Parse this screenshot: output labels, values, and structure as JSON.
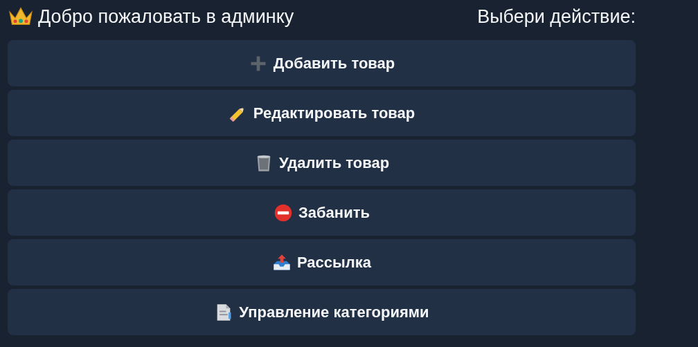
{
  "message": {
    "title": "Добро пожаловать в админку",
    "prompt": "Выбери действие:"
  },
  "buttons": [
    {
      "kind": "plus",
      "label": "Добавить товар"
    },
    {
      "kind": "pencil",
      "label": "Редактировать товар"
    },
    {
      "kind": "trash",
      "label": "Удалить товар"
    },
    {
      "kind": "no-entry",
      "label": "Забанить"
    },
    {
      "kind": "outbox",
      "label": "Рассылка"
    },
    {
      "kind": "document",
      "label": "Управление категориями"
    }
  ]
}
